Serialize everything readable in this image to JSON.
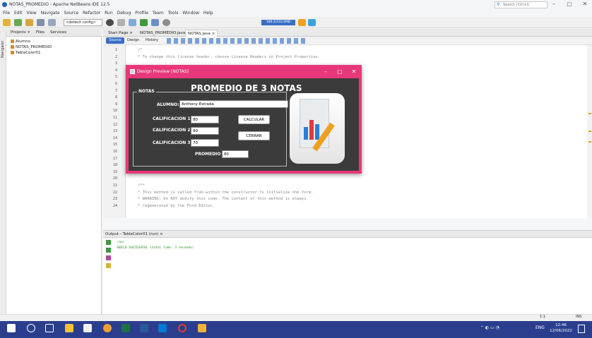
{
  "window": {
    "title": "NOTAS_PROMEDIO - Apache NetBeans IDE 12.5",
    "search_placeholder": "Search (Ctrl+I)",
    "minimize": "–",
    "maximize": "▢",
    "close": "✕"
  },
  "menu": [
    "File",
    "Edit",
    "View",
    "Navigate",
    "Source",
    "Refactor",
    "Run",
    "Debug",
    "Profile",
    "Team",
    "Tools",
    "Window",
    "Help"
  ],
  "toolbar": {
    "config": "<default config>",
    "memory": "189.2/433.0MB"
  },
  "left_panel": {
    "navigator": "Navigator",
    "tabs": [
      "Projects ×",
      "Files",
      "Services"
    ],
    "projects": [
      "Alumno",
      "NOTAS_PROMEDIO",
      "TablaColor01"
    ]
  },
  "editor": {
    "tabs": [
      "Start Page ×",
      "NOTAS_PROMEDIO.java ×",
      "NOTAS.java ×"
    ],
    "source": "Source",
    "design": "Design",
    "history": "History",
    "line_numbers": [
      "1",
      "2",
      "3",
      "4",
      "5",
      "6",
      "7",
      "8",
      "9",
      "10",
      "11",
      "12",
      "13",
      "14",
      "15",
      "16",
      "17",
      "18",
      "19",
      "20",
      "21",
      "22",
      "23",
      "24"
    ],
    "lines": [
      {
        "n": "1",
        "text": "/*"
      },
      {
        "n": "2",
        "text": " * To change this license header, choose License Headers in Project Properties."
      },
      {
        "n": "19",
        "text": "    }"
      },
      {
        "n": "21",
        "text": "    /**"
      },
      {
        "n": "22",
        "text": "     * This method is called from within the constructor to initialize the form."
      },
      {
        "n": "23",
        "text": "     * WARNING: Do NOT modify this code. The content of this method is always"
      },
      {
        "n": "24",
        "text": "     * regenerated by the Form Editor."
      }
    ]
  },
  "output": {
    "tab": "Output - TablaColor01 (run) ×",
    "lines": [
      "run:",
      "BUILD SUCCESSFUL (total time: 3 seconds)"
    ]
  },
  "status": {
    "position": "1:1",
    "mode": "INS"
  },
  "dialog": {
    "title": "Design Preview [NOTAS]",
    "heading": "PROMEDIO DE 3 NOTAS",
    "legend": "NOTAS",
    "alumno_label": "ALUMNO:",
    "alumno_value": "Anthony Estrada",
    "cal1_label": "CALIFICACION 1",
    "cal1_value": "80",
    "cal2_label": "CALIFICACION 2",
    "cal2_value": "90",
    "cal3_label": "CALIFICACION 3",
    "cal3_value": "70",
    "promedio_label": "PROMEDIO",
    "promedio_value": "80",
    "calcular": "CALCULAR",
    "cerrar": "CERRAR"
  },
  "taskbar": {
    "time": "12:46",
    "date": "12/06/2022",
    "lang": "ENG"
  },
  "colors": {
    "accent": "#e8377a",
    "dialog_bg": "#3b3b3b",
    "taskbar": "#2b3e8e"
  }
}
